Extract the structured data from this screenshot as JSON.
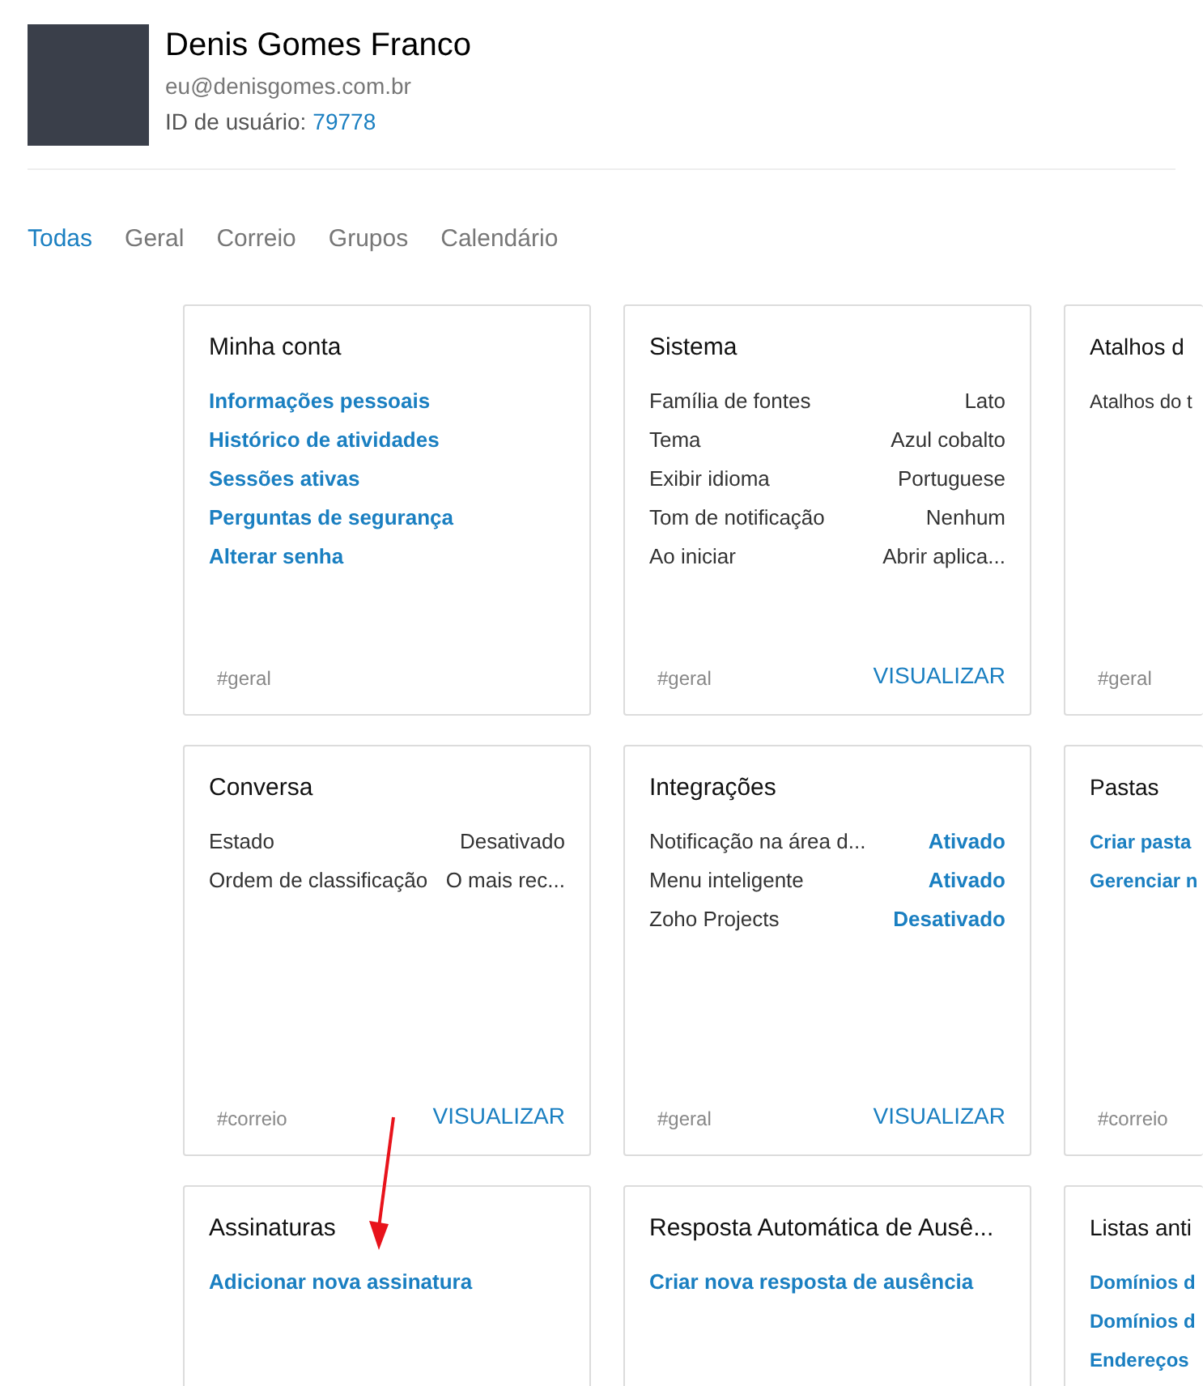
{
  "profile": {
    "name": "Denis Gomes Franco",
    "email": "eu@denisgomes.com.br",
    "id_label": "ID de usuário:",
    "id_value": "79778"
  },
  "tabs": [
    {
      "label": "Todas",
      "selected": true
    },
    {
      "label": "Geral",
      "selected": false
    },
    {
      "label": "Correio",
      "selected": false
    },
    {
      "label": "Grupos",
      "selected": false
    },
    {
      "label": "Calendário",
      "selected": false
    }
  ],
  "cards": [
    {
      "title": "Minha conta",
      "items": [
        {
          "kind": "link",
          "label": "Informações pessoais"
        },
        {
          "kind": "link",
          "label": "Histórico de atividades"
        },
        {
          "kind": "link",
          "label": "Sessões ativas"
        },
        {
          "kind": "link",
          "label": "Perguntas de segurança"
        },
        {
          "kind": "link",
          "label": "Alterar senha"
        }
      ],
      "tag": "#geral"
    },
    {
      "title": "Sistema",
      "items": [
        {
          "kind": "setting",
          "label": "Família de fontes",
          "value": "Lato"
        },
        {
          "kind": "setting",
          "label": "Tema",
          "value": "Azul cobalto"
        },
        {
          "kind": "setting",
          "label": "Exibir idioma",
          "value": "Portuguese"
        },
        {
          "kind": "setting",
          "label": "Tom de notificação",
          "value": "Nenhum"
        },
        {
          "kind": "setting",
          "label": "Ao iniciar",
          "value": "Abrir aplica..."
        }
      ],
      "tag": "#geral",
      "action": "VISUALIZAR"
    },
    {
      "title": "Atalhos d",
      "items": [
        {
          "kind": "text",
          "label": "Atalhos do t"
        }
      ],
      "tag": "#geral"
    },
    {
      "title": "Conversa",
      "items": [
        {
          "kind": "setting",
          "label": "Estado",
          "value": "Desativado"
        },
        {
          "kind": "setting",
          "label": "Ordem de classificação",
          "value": "O mais rec..."
        }
      ],
      "tag": "#correio",
      "action": "VISUALIZAR"
    },
    {
      "title": "Integrações",
      "items": [
        {
          "kind": "toggle",
          "label": "Notificação na área d...",
          "value": "Ativado"
        },
        {
          "kind": "toggle",
          "label": "Menu inteligente",
          "value": "Ativado"
        },
        {
          "kind": "toggle",
          "label": "Zoho Projects",
          "value": "Desativado"
        }
      ],
      "tag": "#geral",
      "action": "VISUALIZAR"
    },
    {
      "title": "Pastas",
      "items": [
        {
          "kind": "link",
          "label": "Criar pasta"
        },
        {
          "kind": "link",
          "label": "Gerenciar n"
        }
      ],
      "tag": "#correio"
    },
    {
      "title": "Assinaturas",
      "items": [
        {
          "kind": "link",
          "label": "Adicionar nova assinatura"
        }
      ]
    },
    {
      "title": "Resposta Automática de Ausê...",
      "items": [
        {
          "kind": "link",
          "label": "Criar nova resposta de ausência"
        }
      ]
    },
    {
      "title": "Listas anti",
      "items": [
        {
          "kind": "link",
          "label": "Domínios d"
        },
        {
          "kind": "link",
          "label": "Domínios d"
        },
        {
          "kind": "link",
          "label": "Endereços"
        }
      ]
    }
  ]
}
